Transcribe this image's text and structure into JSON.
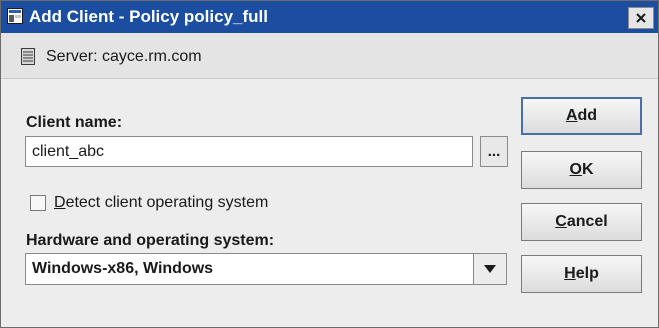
{
  "window": {
    "title": "Add Client - Policy policy_full",
    "close_symbol": "×"
  },
  "server_bar": {
    "icon": "server-icon",
    "text": "Server: cayce.rm.com"
  },
  "form": {
    "client_name_label": "Client name:",
    "client_name_value": "client_abc",
    "browse_label": "...",
    "detect_os": {
      "checked": false,
      "mnemonic": "D",
      "rest": "etect client operating system"
    },
    "hw_os_label": "Hardware and operating system:",
    "hw_os_selected": "Windows-x86, Windows"
  },
  "buttons": {
    "add": {
      "mnemonic": "A",
      "rest": "dd"
    },
    "ok": {
      "mnemonic": "O",
      "rest": "K"
    },
    "cancel": {
      "mnemonic": "C",
      "rest": "ancel"
    },
    "help": {
      "mnemonic": "H",
      "rest": "elp"
    }
  },
  "colors": {
    "titlebar": "#1b4ea0",
    "dialog_background": "#ededed",
    "primary_button_border": "#4a6ea9"
  }
}
